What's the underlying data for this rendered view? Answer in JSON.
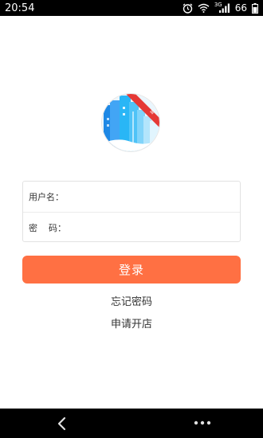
{
  "status_bar": {
    "time": "20:54",
    "network_type": "3G",
    "battery": "66"
  },
  "login_form": {
    "username_label": "用户名：",
    "username_value": "",
    "password_label": "密    码：",
    "password_value": ""
  },
  "login_button": "登录",
  "forgot_password_link": "忘记密码",
  "apply_shop_link": "申请开店",
  "logo": {
    "icon": "city-buildings-logo",
    "colors": [
      "#1e88e5",
      "#4fc3f7",
      "#e53935"
    ]
  },
  "nav_bar": {
    "icons": [
      "back-icon",
      "more-icon"
    ]
  }
}
